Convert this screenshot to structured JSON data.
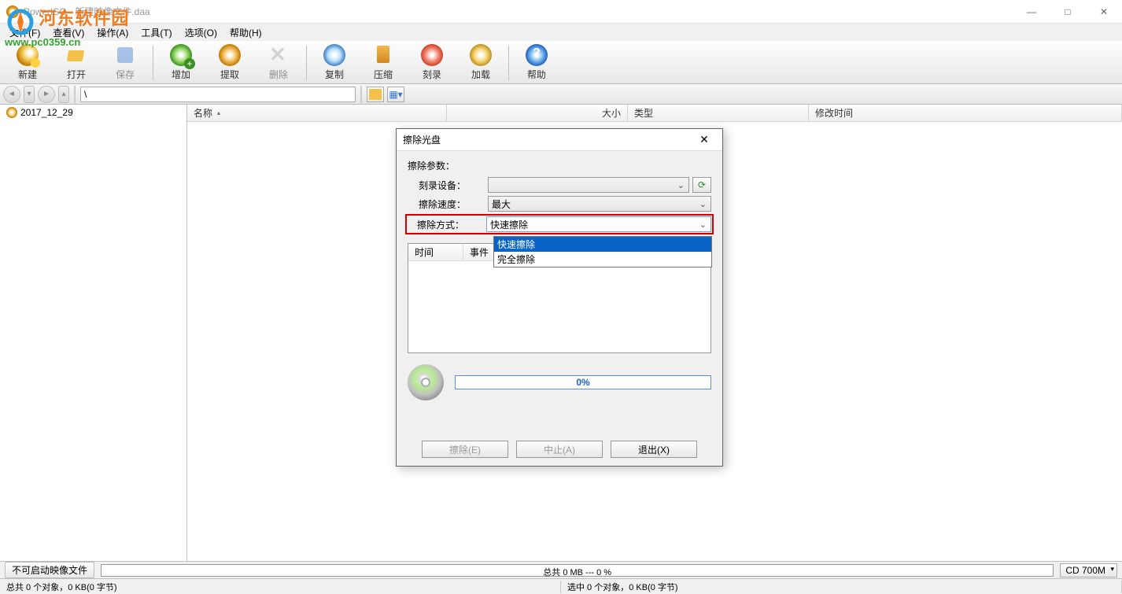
{
  "window": {
    "title": "PowerISO - 新建映像文件.daa",
    "controls": {
      "min": "—",
      "max": "□",
      "close": "✕"
    }
  },
  "watermark": {
    "line1": "河东软件园",
    "line2": "www.pc0359.cn"
  },
  "menu": {
    "file": "文件(F)",
    "view": "查看(V)",
    "action": "操作(A)",
    "tools": "工具(T)",
    "options": "选项(O)",
    "help": "帮助(H)"
  },
  "toolbar": {
    "new": "新建",
    "open": "打开",
    "save": "保存",
    "add": "增加",
    "extract": "提取",
    "delete": "删除",
    "copy": "复制",
    "compress": "压缩",
    "burn": "刻录",
    "mount": "加载",
    "help": "帮助"
  },
  "nav": {
    "path": "\\"
  },
  "tree": {
    "root": "2017_12_29"
  },
  "columns": {
    "name": "名称",
    "size": "大小",
    "type": "类型",
    "mtime": "修改时间",
    "sort": "▴"
  },
  "dialog": {
    "title": "擦除光盘",
    "close": "✕",
    "group": "擦除参数：",
    "device_label": "刻录设备：",
    "device_value": "",
    "refresh_icon": "⟳",
    "speed_label": "擦除速度：",
    "speed_value": "最大",
    "method_label": "擦除方式：",
    "method_value": "快速擦除",
    "options": {
      "quick": "快速擦除",
      "full": "完全擦除"
    },
    "log": {
      "time": "时间",
      "event": "事件"
    },
    "progress": "0%",
    "buttons": {
      "erase": "擦除(E)",
      "abort": "中止(A)",
      "exit": "退出(X)"
    }
  },
  "bottom": {
    "boot_label": "不可启动映像文件",
    "capacity_text": "总共 0 MB --- 0 %",
    "disc_type": "CD 700M"
  },
  "status": {
    "left": "总共 0 个对象，0 KB(0 字节)",
    "right": "选中 0 个对象，0 KB(0 字节)"
  }
}
